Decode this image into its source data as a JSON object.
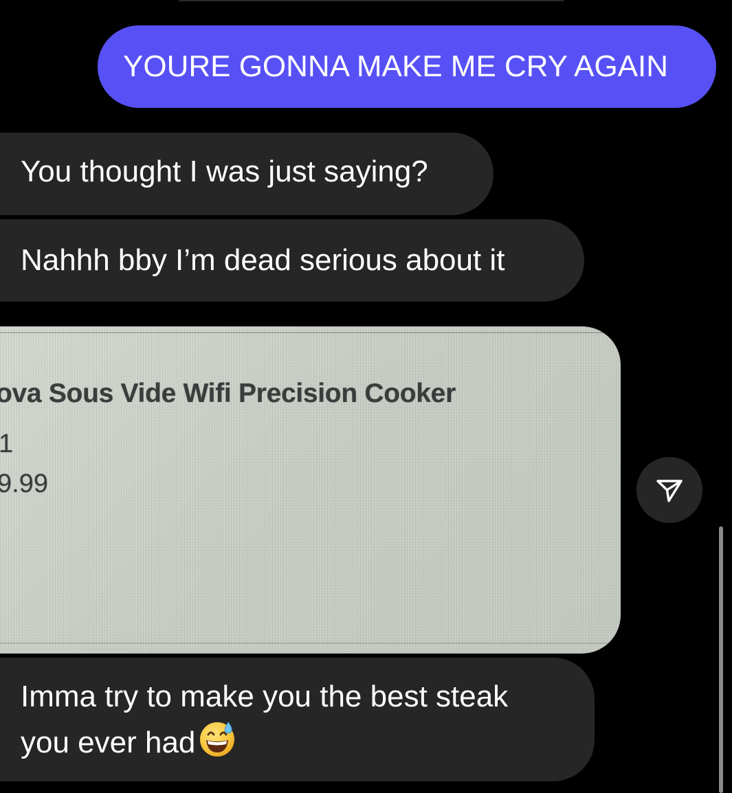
{
  "messages": [
    {
      "id": "m1",
      "direction": "sent",
      "text": "YOURE GONNA MAKE ME CRY AGAIN"
    },
    {
      "id": "m2",
      "direction": "received",
      "text": "You thought I was just saying?"
    },
    {
      "id": "m3",
      "direction": "received",
      "text": "Nahhh bby I’m dead serious about it"
    },
    {
      "id": "m4",
      "direction": "received",
      "type": "image",
      "receipt": {
        "product": "ova Sous Vide Wifi Precision Cooker",
        "quantity": "1",
        "price": "9.99"
      }
    },
    {
      "id": "m5",
      "direction": "received",
      "line1": "Imma try to make you the best steak",
      "line2": "you ever had",
      "emoji": "grinning-face-with-sweat"
    }
  ],
  "share_button": {
    "icon": "paper-plane-icon"
  },
  "colors": {
    "background": "#000000",
    "sent_bubble": "#5751f5",
    "received_bubble": "#262626",
    "text": "#ffffff"
  }
}
